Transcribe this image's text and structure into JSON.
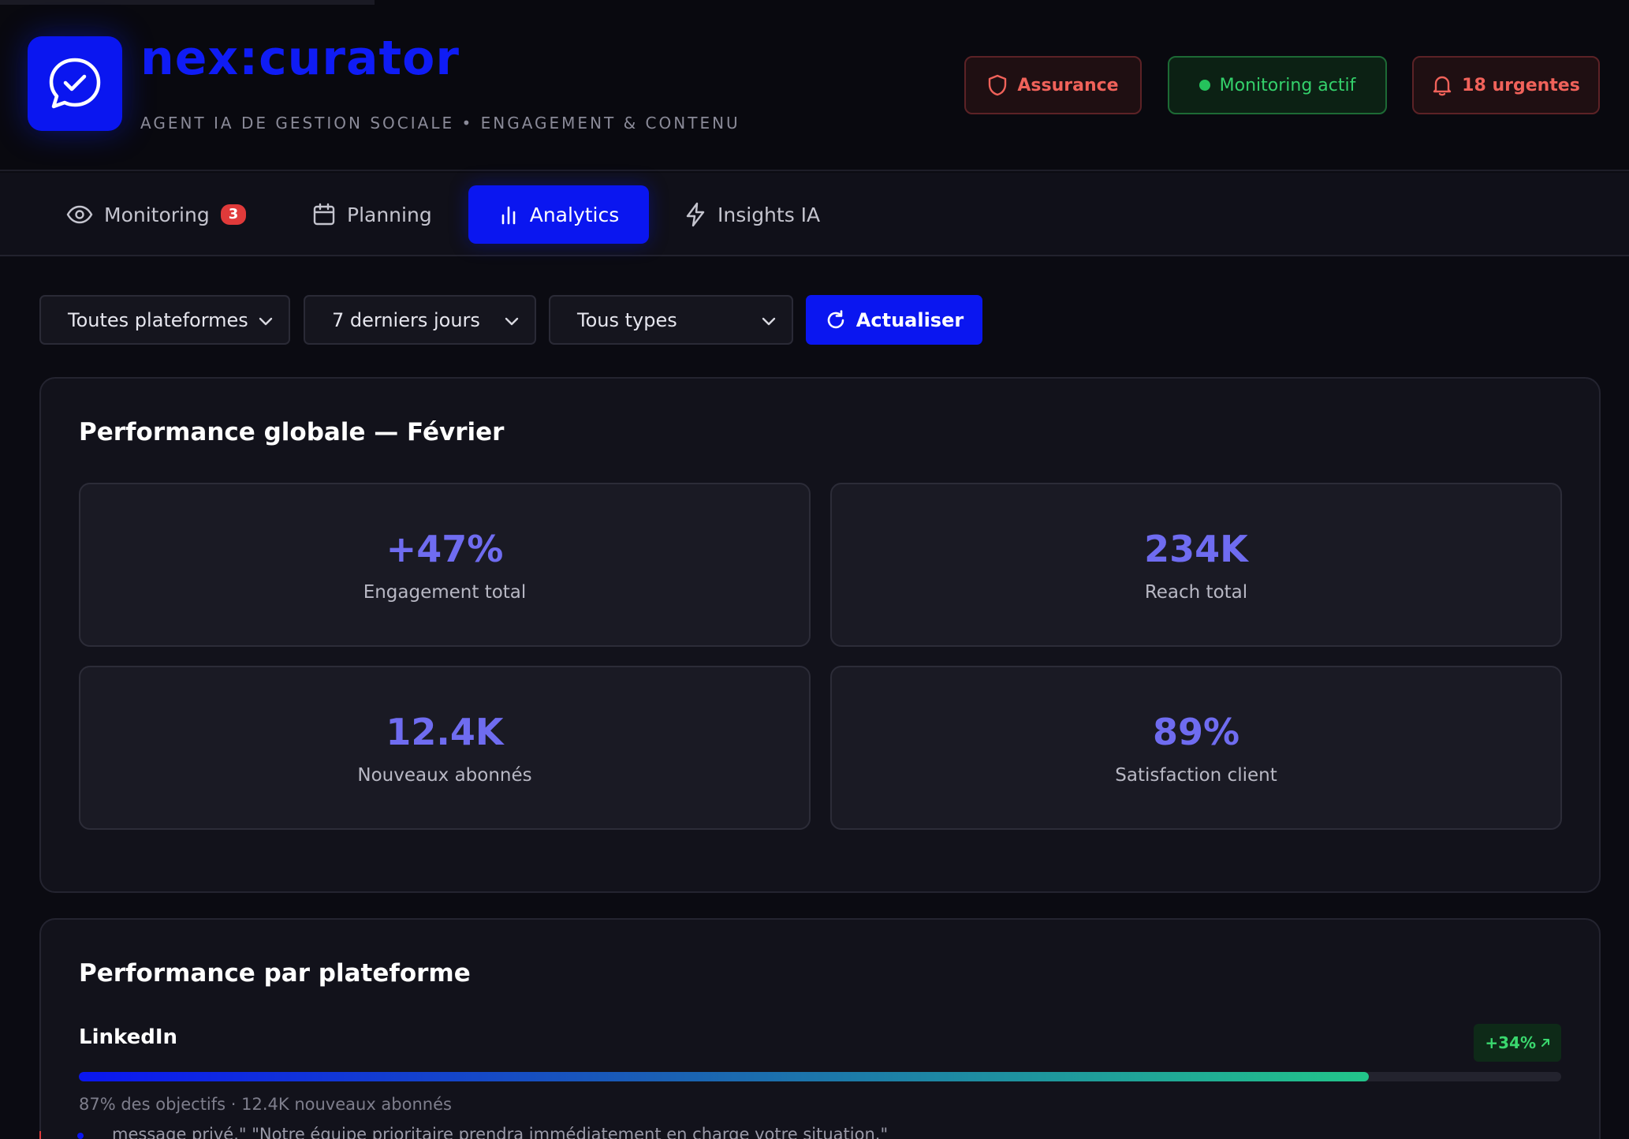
{
  "header": {
    "brand": "nex:curator",
    "subtitle": "AGENT IA DE GESTION SOCIALE • ENGAGEMENT & CONTENU",
    "assurance_label": "Assurance",
    "monitoring_label": "Monitoring actif",
    "urgent_label": "18 urgentes"
  },
  "tabs": [
    {
      "label": "Monitoring",
      "badge": "3",
      "icon": "eye-icon"
    },
    {
      "label": "Planning",
      "icon": "calendar-icon"
    },
    {
      "label": "Analytics",
      "icon": "bar-chart-icon",
      "active": true
    },
    {
      "label": "Insights IA",
      "icon": "lightning-icon"
    }
  ],
  "filters": {
    "platform": "Toutes plateformes",
    "period": "7 derniers jours",
    "type": "Tous types",
    "refresh_label": "Actualiser"
  },
  "global": {
    "title": "Performance globale — Février",
    "kpis": [
      {
        "value": "+47%",
        "label": "Engagement total"
      },
      {
        "value": "234K",
        "label": "Reach total"
      },
      {
        "value": "12.4K",
        "label": "Nouveaux abonnés"
      },
      {
        "value": "89%",
        "label": "Satisfaction client"
      }
    ]
  },
  "platforms": {
    "title": "Performance par plateforme",
    "items": [
      {
        "name": "LinkedIn",
        "delta": "+34%",
        "progress": 0.87,
        "meta": "87% des objectifs · 12.4K nouveaux abonnés"
      }
    ]
  },
  "message_preview": "message privé.\" \"Notre équipe prioritaire prendra immédiatement en charge votre situation.\"",
  "colors": {
    "accent": "#0a16f0",
    "kpi_value": "#6f6cf0",
    "danger": "#f0625a",
    "success": "#34d16b"
  }
}
